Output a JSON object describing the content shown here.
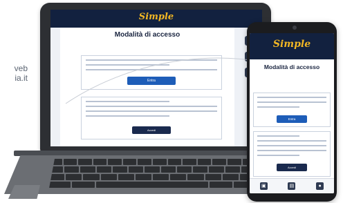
{
  "side_text": {
    "line1": "veb",
    "line2": "ia.it"
  },
  "laptop": {
    "logo": "Simple",
    "page_title": "Modalità di accesso",
    "login_button": "Entra",
    "access_button": "Accedi",
    "side_icons": [
      {
        "icon": "user-icon",
        "glyph": "⚙"
      },
      {
        "icon": "card-icon",
        "glyph": "▣"
      },
      {
        "icon": "lock-icon",
        "glyph": "●"
      }
    ]
  },
  "phone": {
    "logo": "Simple",
    "page_title": "Modalità di accesso",
    "login_button": "Entra",
    "access_button": "Accedi",
    "nav_items": [
      {
        "icon": "home-icon",
        "glyph": "▣"
      },
      {
        "icon": "id-icon",
        "glyph": "▤"
      },
      {
        "icon": "profile-icon",
        "glyph": "●"
      }
    ]
  },
  "colors": {
    "header_navy": "#12213f",
    "logo_gold": "#f2b724",
    "button_blue": "#1e5db8",
    "button_dark": "#1a2a4e",
    "device_body": "#2d2f33"
  }
}
